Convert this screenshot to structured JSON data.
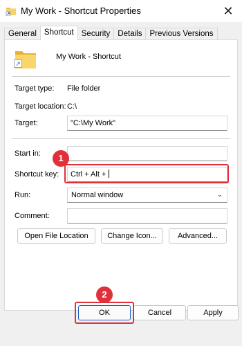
{
  "window": {
    "title": "My Work - Shortcut Properties",
    "close": "✕"
  },
  "tabs": [
    {
      "label": "General"
    },
    {
      "label": "Shortcut"
    },
    {
      "label": "Security"
    },
    {
      "label": "Details"
    },
    {
      "label": "Previous Versions"
    }
  ],
  "shortcut_name": "My Work - Shortcut",
  "target_type": {
    "label": "Target type:",
    "value": "File folder"
  },
  "target_location": {
    "label": "Target location:",
    "value": "C:\\"
  },
  "target": {
    "label": "Target:",
    "value": "\"C:\\My Work\""
  },
  "start_in": {
    "label": "Start in:",
    "value": ""
  },
  "shortcut_key": {
    "label": "Shortcut key:",
    "value": "Ctrl + Alt + "
  },
  "run": {
    "label": "Run:",
    "value": "Normal window"
  },
  "comment": {
    "label": "Comment:",
    "value": ""
  },
  "buttons": {
    "open_file_location": "Open File Location",
    "change_icon": "Change Icon...",
    "advanced": "Advanced...",
    "ok": "OK",
    "cancel": "Cancel",
    "apply": "Apply"
  },
  "annotations": {
    "step1": "1",
    "step2": "2",
    "color": "#e0313b"
  }
}
